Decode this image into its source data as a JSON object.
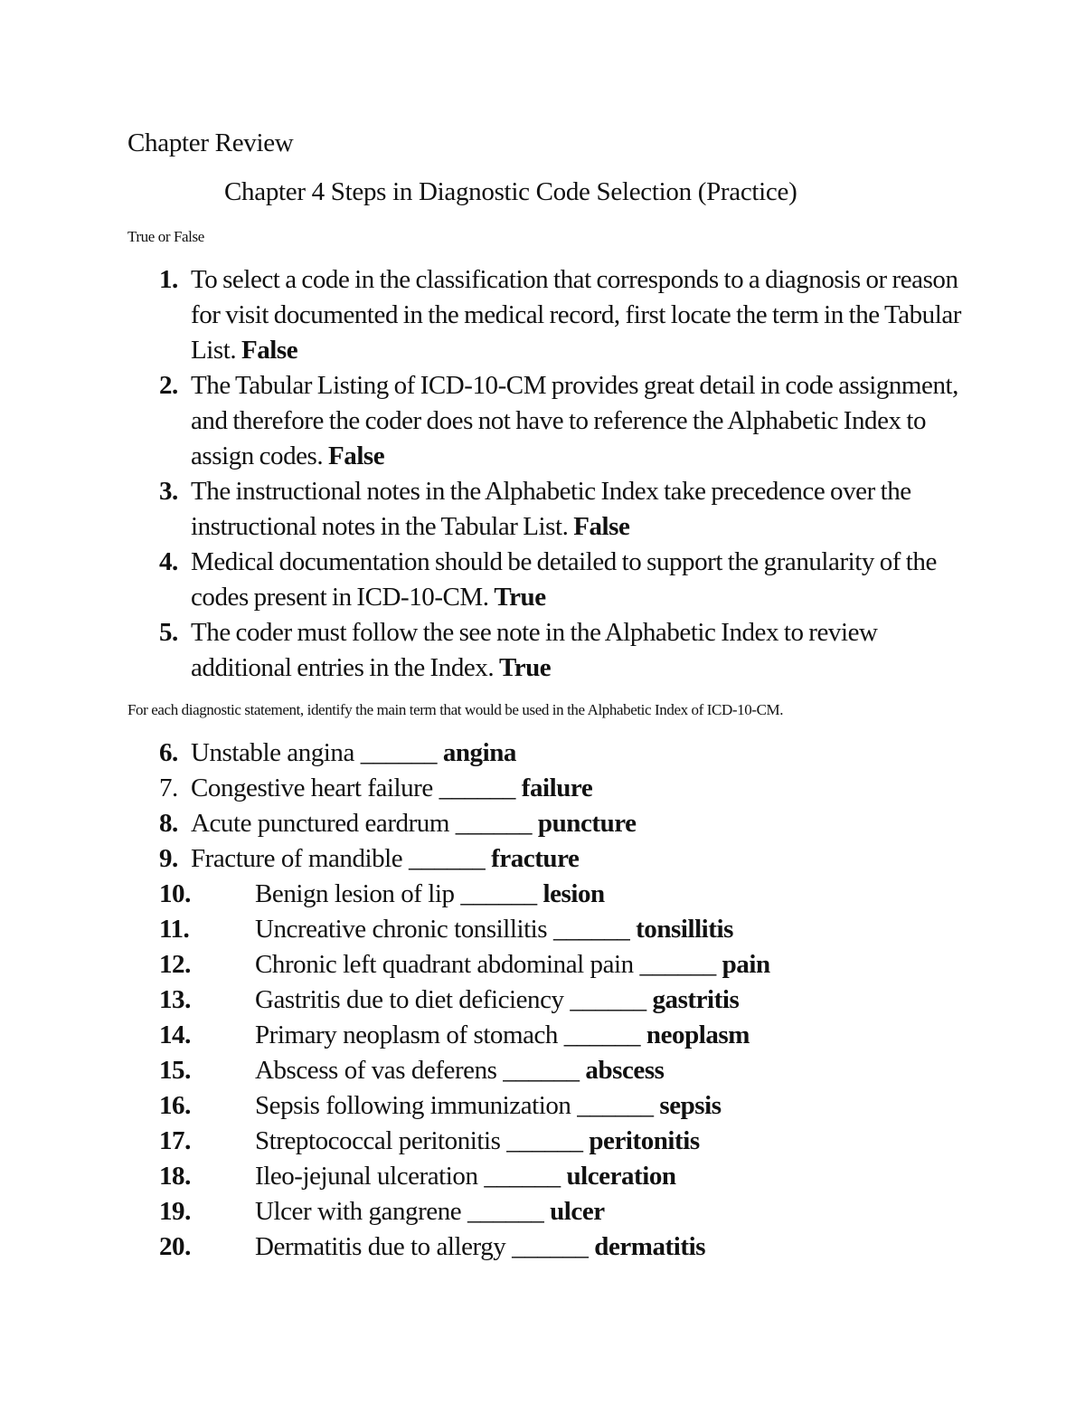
{
  "document": {
    "heading": "Chapter Review",
    "subtitle": "Chapter 4 Steps in Diagnostic Code Selection (Practice)",
    "true_false": {
      "label": "True or False",
      "items": [
        {
          "number": "1.",
          "text": "To select a code in the classification that corresponds to a diagnosis or reason for visit documented in the medical record, first locate the term in the Tabular List.",
          "answer": "False"
        },
        {
          "number": "2.",
          "text": "The Tabular Listing of ICD-10-CM provides great detail in code assignment, and therefore the coder does not have to reference the Alphabetic Index to assign codes.",
          "answer": "False"
        },
        {
          "number": "3.",
          "text": "The instructional notes in the Alphabetic Index take precedence over the instructional notes in the Tabular List.",
          "answer": "False"
        },
        {
          "number": "4.",
          "text": "Medical documentation should be detailed to support the granularity of the codes present in ICD-10-CM.",
          "answer": "True"
        },
        {
          "number": "5.",
          "text": "The coder must follow the see note in the Alphabetic Index to review additional entries in the Index.",
          "answer": "True"
        }
      ]
    },
    "main_terms": {
      "label": "For each diagnostic statement, identify the main term that would be used in the Alphabetic Index of ICD-10-CM.",
      "blank": "______",
      "items": [
        {
          "number": "6.",
          "statement": "Unstable angina",
          "answer": "angina"
        },
        {
          "number": "7.",
          "statement": "Congestive heart failure",
          "answer": "failure"
        },
        {
          "number": "8.",
          "statement": "Acute punctured eardrum",
          "answer": "puncture"
        },
        {
          "number": "9.",
          "statement": "Fracture of mandible",
          "answer": "fracture"
        },
        {
          "number": "10.",
          "statement": "Benign lesion of lip",
          "answer": "lesion"
        },
        {
          "number": "11.",
          "statement": "Uncreative chronic tonsillitis",
          "answer": "tonsillitis"
        },
        {
          "number": "12.",
          "statement": "Chronic left quadrant abdominal pain",
          "answer": "pain"
        },
        {
          "number": "13.",
          "statement": "Gastritis due to diet deficiency",
          "answer": "gastritis"
        },
        {
          "number": "14.",
          "statement": "Primary neoplasm of stomach",
          "answer": "neoplasm"
        },
        {
          "number": "15.",
          "statement": "Abscess of vas deferens",
          "answer": "abscess"
        },
        {
          "number": "16.",
          "statement": "Sepsis following immunization",
          "answer": "sepsis"
        },
        {
          "number": "17.",
          "statement": "Streptococcal peritonitis",
          "answer": "peritonitis"
        },
        {
          "number": "18.",
          "statement": "Ileo-jejunal ulceration",
          "answer": "ulceration"
        },
        {
          "number": "19.",
          "statement": "Ulcer with gangrene",
          "answer": "ulcer"
        },
        {
          "number": "20.",
          "statement": "Dermatitis due to allergy",
          "answer": "dermatitis"
        }
      ]
    }
  }
}
